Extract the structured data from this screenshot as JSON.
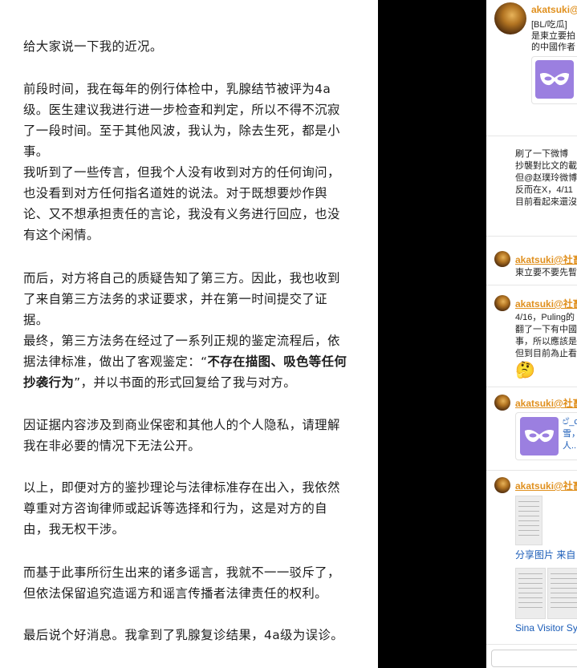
{
  "article": {
    "paragraphs": [
      "给大家说一下我的近况。",
      "前段时间，我在每年的例行体检中，乳腺结节被评为4a级。医生建议我进行进一步检查和判定，所以不得不沉寂了一段时间。至于其他风波，我认为，除去生死，都是小事。",
      "我听到了一些传言，但我个人没有收到对方的任何询问，也没看到对方任何指名道姓的说法。对于既想要炒作舆论、又不想承担责任的言论，我没有义务进行回应，也没有这个闲情。",
      "而后，对方将自己的质疑告知了第三方。因此，我也收到了来自第三方法务的求证要求，并在第一时间提交了证据。",
      "最终，第三方法务在经过了一系列正规的鉴定流程后，依据法律标准，做出了客观鉴定：“",
      "不存在描图、吸色等任何抄袭行为",
      "”，并以书面的形式回复给了我与对方。",
      "因证据内容涉及到商业保密和其他人的个人隐私，请理解我在非必要的情况下无法公开。",
      "以上，即便对方的鉴抄理论与法律标准存在出入，我依然尊重对方咨询律师或起诉等选择和行为，这是对方的自由，我无权干涉。",
      "而基于此事所衍生出来的诸多谣言，我就不一一驳斥了，但依法保留追究造谣方和谣言传播者法律责任的权利。",
      "最后说个好消息。我拿到了乳腺复诊结果，4a级为误诊。"
    ]
  },
  "feed": {
    "post1": {
      "username": "akatsuki@",
      "line1": "[BL/吃瓜]",
      "line2": "是東立要拍",
      "line3": "的中國作者"
    },
    "post2": {
      "line1": "刷了一下微博",
      "line2": "抄襲對比文的載",
      "line3": "但@赵璞玲微博",
      "line4": "反而在X，4/11",
      "line5": "目前看起來還沒"
    },
    "reply1": {
      "username": "akatsuki@社畜",
      "text": "東立要不要先暫"
    },
    "reply2": {
      "username": "akatsuki@社畜",
      "line1": "4/16，Puling的",
      "line2": "翻了一下有中國",
      "line3": "事，所以應該是",
      "line4": "但到目前為止看",
      "emoji": "🤔"
    },
    "reply3": {
      "username": "akatsuki@社畜",
      "card_line1": "ඒ_c",
      "card_line2": "雪，",
      "card_line3": "人..."
    },
    "reply4": {
      "username": "akatsuki@社畜",
      "caption1": "分享图片 来自",
      "caption2": "Sina Visitor Sy"
    }
  }
}
